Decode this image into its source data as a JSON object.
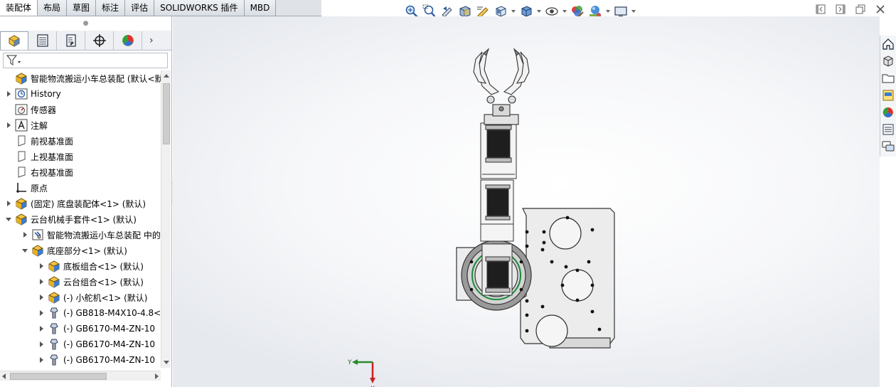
{
  "command_tabs": [
    "装配体",
    "布局",
    "草图",
    "标注",
    "评估",
    "SOLIDWORKS 插件",
    "MBD"
  ],
  "active_tab_index": 0,
  "heads_up_toolbar": [
    "zoom-to-fit-icon",
    "zoom-to-area-icon",
    "previous-view-icon",
    "section-view-icon",
    "dynamic-annotation-icon",
    "view-orientation-icon",
    "display-style-icon",
    "hide-show-items-icon",
    "edit-appearance-icon",
    "apply-scene-icon",
    "view-settings-icon"
  ],
  "feature_manager": {
    "tabs": [
      "feature-tree-icon",
      "property-manager-icon",
      "configuration-manager-icon",
      "dimxpert-icon",
      "display-manager-icon"
    ],
    "tree": [
      {
        "level": 0,
        "toggle": "none",
        "icon": "assembly-icon",
        "label": "智能物流搬运小车总装配  (默认<默认"
      },
      {
        "level": 0,
        "toggle": "closed",
        "icon": "history-icon",
        "label": "History"
      },
      {
        "level": 0,
        "toggle": "none",
        "icon": "sensor-icon",
        "label": "传感器"
      },
      {
        "level": 0,
        "toggle": "closed",
        "icon": "annotation-icon",
        "label": "注解"
      },
      {
        "level": 0,
        "toggle": "none",
        "icon": "plane-icon",
        "label": "前视基准面"
      },
      {
        "level": 0,
        "toggle": "none",
        "icon": "plane-icon",
        "label": "上视基准面"
      },
      {
        "level": 0,
        "toggle": "none",
        "icon": "plane-icon",
        "label": "右视基准面"
      },
      {
        "level": 0,
        "toggle": "none",
        "icon": "origin-icon",
        "label": "原点"
      },
      {
        "level": 0,
        "toggle": "closed",
        "icon": "assembly-icon",
        "label": "(固定) 底盘装配体<1> (默认)"
      },
      {
        "level": 0,
        "toggle": "open",
        "icon": "assembly-icon",
        "label": "云台机械手套件<1> (默认)"
      },
      {
        "level": 1,
        "toggle": "closed",
        "icon": "mates-icon",
        "label": "智能物流搬运小车总装配 中的"
      },
      {
        "level": 1,
        "toggle": "open",
        "icon": "assembly-icon",
        "label": "底座部分<1> (默认)"
      },
      {
        "level": 2,
        "toggle": "closed",
        "icon": "assembly-icon",
        "label": "底板组合<1> (默认)"
      },
      {
        "level": 2,
        "toggle": "closed",
        "icon": "assembly-icon",
        "label": "云台组合<1> (默认)"
      },
      {
        "level": 2,
        "toggle": "closed",
        "icon": "assembly-icon",
        "label": "(-) 小舵机<1> (默认)"
      },
      {
        "level": 2,
        "toggle": "closed",
        "icon": "part-icon",
        "label": "(-) GB818-M4X10-4.8<"
      },
      {
        "level": 2,
        "toggle": "closed",
        "icon": "part-icon",
        "label": "(-) GB6170-M4-ZN-10"
      },
      {
        "level": 2,
        "toggle": "closed",
        "icon": "part-icon",
        "label": "(-) GB6170-M4-ZN-10"
      },
      {
        "level": 2,
        "toggle": "closed",
        "icon": "part-icon",
        "label": "(-) GB6170-M4-ZN-10"
      }
    ]
  },
  "triad": {
    "x_label": "X",
    "y_label": "Y"
  },
  "task_pane": [
    "home-icon",
    "design-library-icon",
    "file-explorer-icon",
    "view-palette-icon",
    "appearances-icon",
    "custom-properties-icon",
    "forum-icon"
  ],
  "window_controls": [
    "tile-left-icon",
    "tile-right-icon",
    "restore-icon",
    "close-icon"
  ],
  "colors": {
    "accent": "#1b6fc9",
    "axis_x": "#cc2020",
    "axis_y": "#2a8a2a",
    "model_fill": "#e8e8e8",
    "model_dark": "#1e1e1e",
    "viewport_bg": "#f3f4f6"
  }
}
